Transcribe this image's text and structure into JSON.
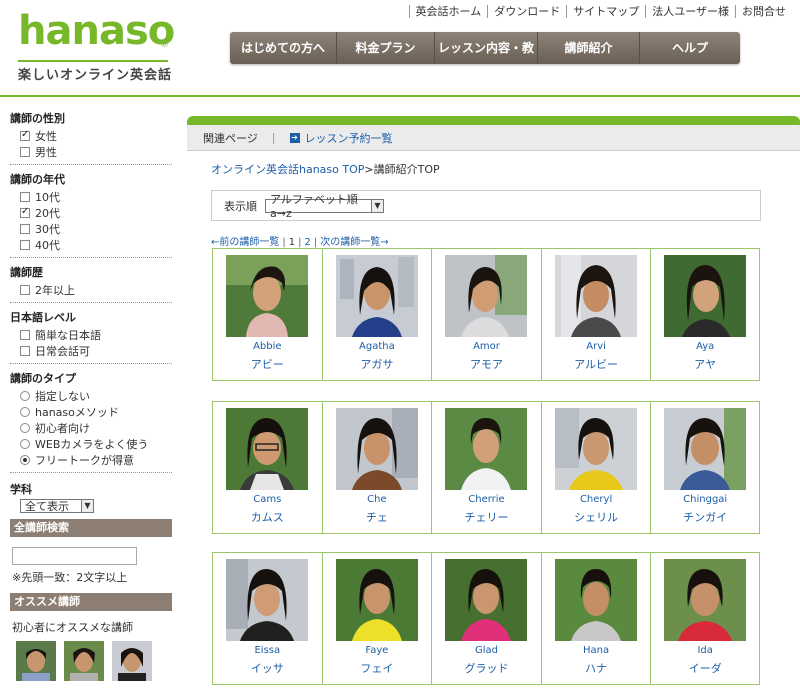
{
  "logo": {
    "word": "hanaso",
    "reg": "®",
    "tagline": "楽しいオンライン英会話"
  },
  "toplinks": [
    "英会話ホーム",
    "ダウンロード",
    "サイトマップ",
    "法人ユーザー様",
    "お問合せ"
  ],
  "gnav": [
    {
      "label": "はじめての方へ"
    },
    {
      "label": "料金プラン"
    },
    {
      "label": "レッスン内容・教材"
    },
    {
      "label": "講師紹介"
    },
    {
      "label": "ヘルプ"
    }
  ],
  "sidebar": {
    "gender": {
      "title": "講師の性別",
      "options": [
        {
          "label": "女性",
          "checked": true
        },
        {
          "label": "男性",
          "checked": false
        }
      ]
    },
    "age": {
      "title": "講師の年代",
      "options": [
        {
          "label": "10代",
          "checked": false
        },
        {
          "label": "20代",
          "checked": true
        },
        {
          "label": "30代",
          "checked": false
        },
        {
          "label": "40代",
          "checked": false
        }
      ]
    },
    "career": {
      "title": "講師歴",
      "options": [
        {
          "label": "2年以上",
          "checked": false
        }
      ]
    },
    "japanese": {
      "title": "日本語レベル",
      "options": [
        {
          "label": "簡単な日本語",
          "checked": false
        },
        {
          "label": "日常会話可",
          "checked": false
        }
      ]
    },
    "type": {
      "title": "講師のタイプ",
      "options": [
        {
          "label": "指定しない",
          "checked": false
        },
        {
          "label": "hanasoメソッド",
          "checked": false
        },
        {
          "label": "初心者向け",
          "checked": false
        },
        {
          "label": "WEBカメラをよく使う",
          "checked": false
        },
        {
          "label": "フリートークが得意",
          "checked": true
        }
      ]
    },
    "subject": {
      "title": "学科",
      "value": "全て表示"
    },
    "search": {
      "title": "全講師検索",
      "note": "※先頭一致：2文字以上"
    },
    "recommend": {
      "title": "オススメ講師",
      "label": "初心者にオススメな講師"
    }
  },
  "main": {
    "related": "関連ページ",
    "related_link": "レッスン予約一覧",
    "crumb_link": "オンライン英会話hanaso TOP",
    "crumb_sep": ">",
    "crumb_current": "講師紹介TOP",
    "sort_label": "表示順",
    "sort_value": "アルファベット順 a→z",
    "pager": {
      "prev": "←前の講師一覧",
      "p1": "1",
      "p2": "2",
      "next": "次の講師一覧→"
    }
  },
  "teachers": [
    [
      {
        "en": "Abbie",
        "jp": "アビー"
      },
      {
        "en": "Agatha",
        "jp": "アガサ"
      },
      {
        "en": "Amor",
        "jp": "アモア"
      },
      {
        "en": "Arvi",
        "jp": "アルビー"
      },
      {
        "en": "Aya",
        "jp": "アヤ"
      }
    ],
    [
      {
        "en": "Cams",
        "jp": "カムス"
      },
      {
        "en": "Che",
        "jp": "チェ"
      },
      {
        "en": "Cherrie",
        "jp": "チェリー"
      },
      {
        "en": "Cheryl",
        "jp": "シェリル"
      },
      {
        "en": "Chinggai",
        "jp": "チンガイ"
      }
    ],
    [
      {
        "en": "Eissa",
        "jp": "イッサ"
      },
      {
        "en": "Faye",
        "jp": "フェイ"
      },
      {
        "en": "Glad",
        "jp": "グラッド"
      },
      {
        "en": "Hana",
        "jp": "ハナ"
      },
      {
        "en": "Ida",
        "jp": "イーダ"
      }
    ]
  ],
  "colors": {
    "brand_green": "#76b82a",
    "link": "#1d5ea8",
    "nav_brown": "#7a6f64"
  }
}
